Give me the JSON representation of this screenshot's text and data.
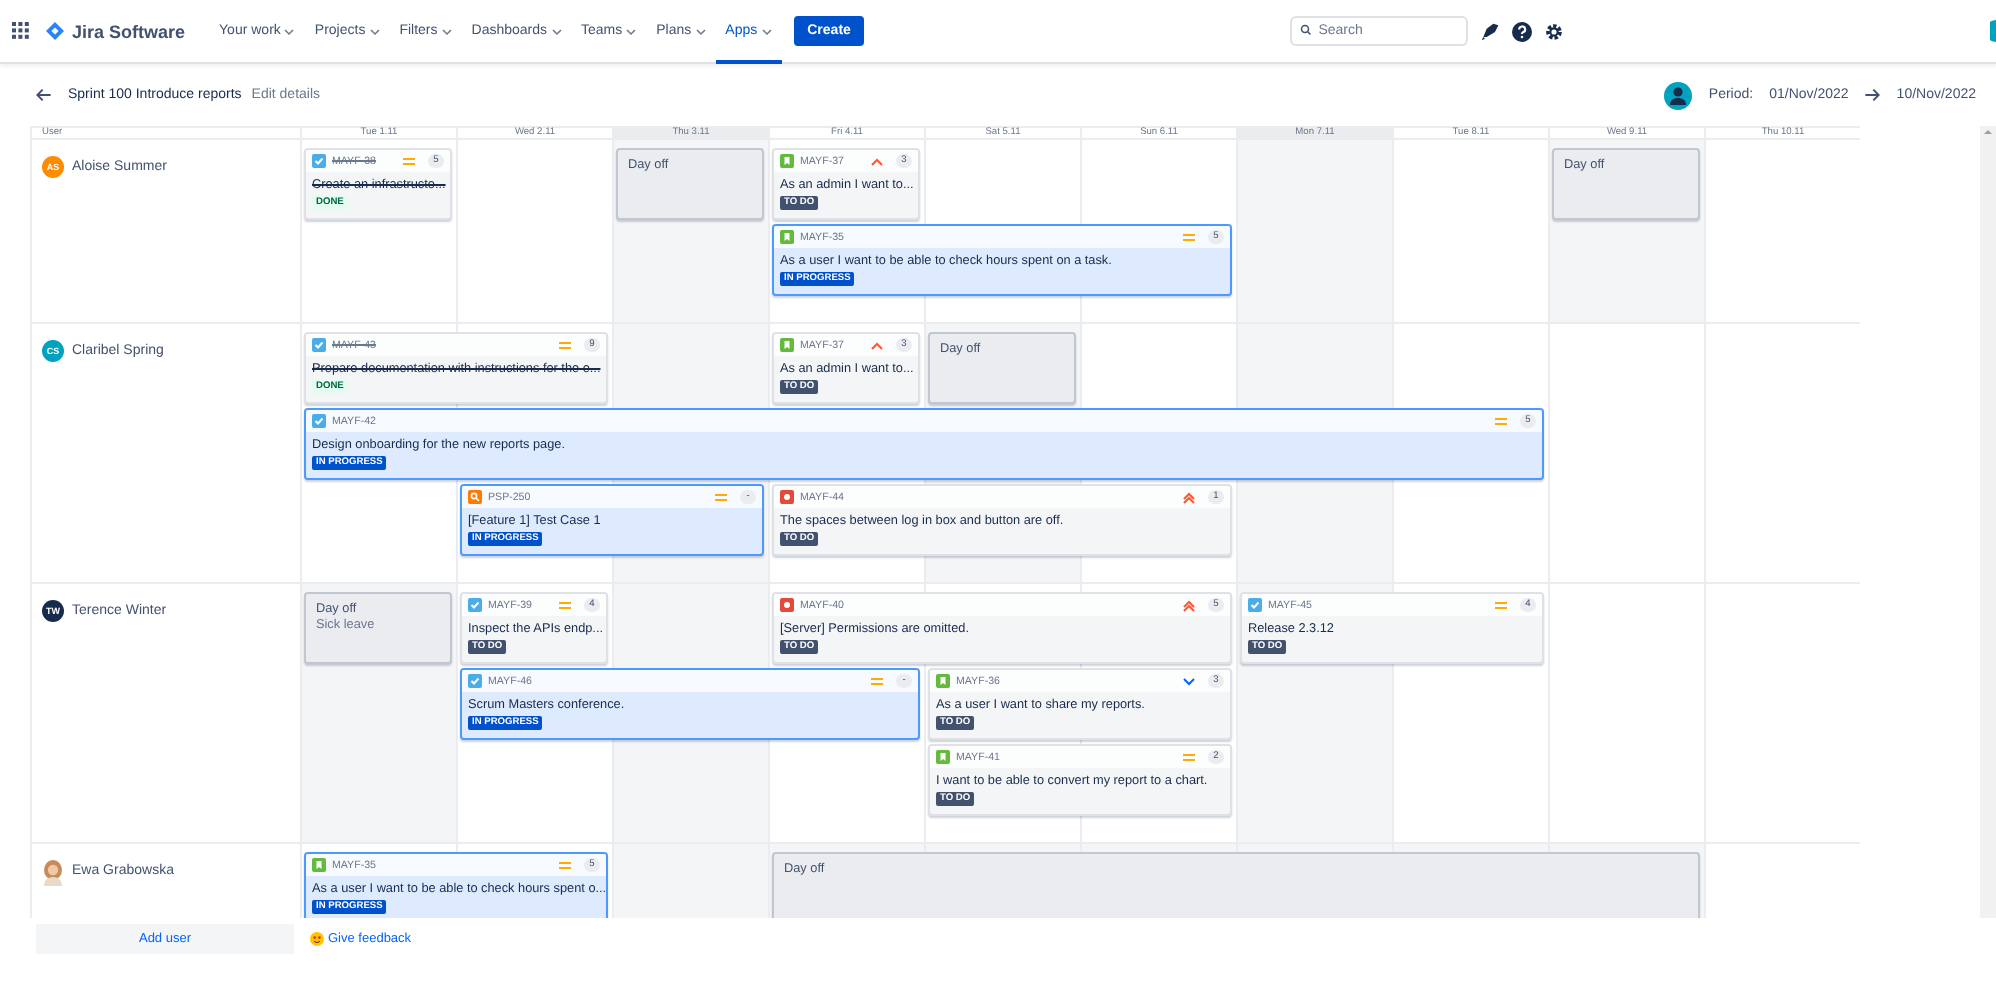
{
  "nav": {
    "product": "Jira Software",
    "menu": [
      {
        "label": "Your work",
        "selected": false
      },
      {
        "label": "Projects",
        "selected": false
      },
      {
        "label": "Filters",
        "selected": false
      },
      {
        "label": "Dashboards",
        "selected": false
      },
      {
        "label": "Teams",
        "selected": false
      },
      {
        "label": "Plans",
        "selected": false
      },
      {
        "label": "Apps",
        "selected": true
      }
    ],
    "create": "Create",
    "search": {
      "placeholder": "Search"
    }
  },
  "sprint": {
    "title": "Sprint 100 Introduce reports",
    "edit": "Edit details"
  },
  "period": {
    "label": "Period:",
    "start": "01/Nov/2022",
    "end": "10/Nov/2022"
  },
  "table": {
    "user_header": "User",
    "days": [
      {
        "label": "Tue 1.11",
        "shaded": false
      },
      {
        "label": "Wed 2.11",
        "shaded": false
      },
      {
        "label": "Thu 3.11",
        "shaded": true
      },
      {
        "label": "Fri 4.11",
        "shaded": false
      },
      {
        "label": "Sat 5.11",
        "shaded": false
      },
      {
        "label": "Sun 6.11",
        "shaded": false
      },
      {
        "label": "Mon 7.11",
        "shaded": true
      },
      {
        "label": "Tue 8.11",
        "shaded": false
      },
      {
        "label": "Wed 9.11",
        "shaded": false
      },
      {
        "label": "Thu 10.11",
        "shaded": false
      }
    ]
  },
  "users": [
    {
      "name": "Aloise Summer",
      "avatar": {
        "kind": "initials",
        "initials": "AS",
        "color": "#ff8b00"
      },
      "lanes": [
        [
          {
            "kind": "issue",
            "key": "MAYF-38",
            "icon": {
              "kind": "task"
            },
            "priority": {
              "kind": "medium"
            },
            "points": "5",
            "title": "Create an infrastructo...",
            "status": {
              "label": "DONE",
              "kind": "done"
            }
          },
          {
            "kind": "empty"
          },
          {
            "kind": "day_off",
            "title": "Day off"
          },
          {
            "kind": "issue",
            "key": "MAYF-37",
            "icon": {
              "kind": "story"
            },
            "priority": {
              "kind": "high"
            },
            "points": "3",
            "title": "As an admin I want to...",
            "status": {
              "label": "TO DO",
              "kind": "todo"
            }
          },
          {
            "kind": "empty"
          },
          {
            "kind": "empty"
          },
          {
            "kind": "empty"
          },
          {
            "kind": "empty"
          },
          {
            "kind": "day_off",
            "title": "Day off"
          },
          {
            "kind": "empty"
          }
        ],
        [
          {
            "kind": "empty"
          },
          {
            "kind": "empty"
          },
          {
            "kind": "empty"
          },
          {
            "kind": "issue",
            "key": "MAYF-35",
            "icon": {
              "kind": "story"
            },
            "priority": {
              "kind": "medium"
            },
            "points": "5",
            "title": "As a user I want to be able to check hours spent on a task.",
            "status": {
              "label": "IN PROGRESS",
              "kind": "in_progress"
            }
          },
          {
            "kind": "continued"
          },
          {
            "kind": "continued"
          },
          {
            "kind": "empty"
          },
          {
            "kind": "empty"
          },
          {
            "kind": "empty"
          },
          {
            "kind": "empty"
          }
        ]
      ]
    },
    {
      "name": "Claribel Spring",
      "avatar": {
        "kind": "initials",
        "initials": "CS",
        "color": "#00a3bf"
      },
      "lanes": [
        [
          {
            "kind": "issue",
            "key": "MAYF-43",
            "icon": {
              "kind": "task"
            },
            "priority": {
              "kind": "medium"
            },
            "points": "9",
            "title": "Prepare documentation with instructions for the e...",
            "status": {
              "label": "DONE",
              "kind": "done"
            }
          },
          {
            "kind": "continued"
          },
          {
            "kind": "empty"
          },
          {
            "kind": "issue",
            "key": "MAYF-37",
            "icon": {
              "kind": "story"
            },
            "priority": {
              "kind": "high"
            },
            "points": "3",
            "title": "As an admin I want to...",
            "status": {
              "label": "TO DO",
              "kind": "todo"
            }
          },
          {
            "kind": "day_off",
            "title": "Day off"
          },
          {
            "kind": "empty"
          },
          {
            "kind": "empty"
          },
          {
            "kind": "empty"
          },
          {
            "kind": "empty"
          },
          {
            "kind": "empty"
          }
        ],
        [
          {
            "kind": "issue",
            "key": "MAYF-42",
            "icon": {
              "kind": "task"
            },
            "priority": {
              "kind": "medium"
            },
            "points": "5",
            "title": "Design onboarding for the new reports page.",
            "status": {
              "label": "IN PROGRESS",
              "kind": "in_progress"
            }
          },
          {
            "kind": "continued"
          },
          {
            "kind": "continued"
          },
          {
            "kind": "continued"
          },
          {
            "kind": "continued"
          },
          {
            "kind": "continued"
          },
          {
            "kind": "continued"
          },
          {
            "kind": "continued"
          },
          {
            "kind": "empty"
          },
          {
            "kind": "empty"
          }
        ],
        [
          {
            "kind": "empty"
          },
          {
            "kind": "issue",
            "key": "PSP-250",
            "icon": {
              "kind": "test"
            },
            "priority": {
              "kind": "medium"
            },
            "points": "-",
            "title": "[Feature 1] Test Case 1",
            "status": {
              "label": "IN PROGRESS",
              "kind": "in_progress"
            }
          },
          {
            "kind": "continued"
          },
          {
            "kind": "issue",
            "key": "MAYF-44",
            "icon": {
              "kind": "bug"
            },
            "priority": {
              "kind": "highest"
            },
            "points": "1",
            "title": "The spaces between log in box and button are off.",
            "status": {
              "label": "TO DO",
              "kind": "todo"
            }
          },
          {
            "kind": "continued"
          },
          {
            "kind": "continued"
          },
          {
            "kind": "empty"
          },
          {
            "kind": "empty"
          },
          {
            "kind": "empty"
          },
          {
            "kind": "empty"
          }
        ]
      ]
    },
    {
      "name": "Terence Winter",
      "avatar": {
        "kind": "initials",
        "initials": "TW",
        "color": "#172b4d"
      },
      "lanes": [
        [
          {
            "kind": "day_off",
            "title": "Day off",
            "note": "Sick leave"
          },
          {
            "kind": "issue",
            "key": "MAYF-39",
            "icon": {
              "kind": "task"
            },
            "priority": {
              "kind": "medium"
            },
            "points": "4",
            "title": "Inspect the APIs endp...",
            "status": {
              "label": "TO DO",
              "kind": "todo"
            }
          },
          {
            "kind": "empty"
          },
          {
            "kind": "issue",
            "key": "MAYF-40",
            "icon": {
              "kind": "bug"
            },
            "priority": {
              "kind": "highest"
            },
            "points": "5",
            "title": "[Server] Permissions are omitted.",
            "status": {
              "label": "TO DO",
              "kind": "todo"
            }
          },
          {
            "kind": "continued"
          },
          {
            "kind": "continued"
          },
          {
            "kind": "issue",
            "key": "MAYF-45",
            "icon": {
              "kind": "task"
            },
            "priority": {
              "kind": "medium"
            },
            "points": "4",
            "title": "Release 2.3.12",
            "status": {
              "label": "TO DO",
              "kind": "todo"
            }
          },
          {
            "kind": "continued"
          },
          {
            "kind": "empty"
          },
          {
            "kind": "empty"
          }
        ],
        [
          {
            "kind": "empty"
          },
          {
            "kind": "issue",
            "key": "MAYF-46",
            "icon": {
              "kind": "task"
            },
            "priority": {
              "kind": "medium"
            },
            "points": "-",
            "title": "Scrum Masters conference.",
            "status": {
              "label": "IN PROGRESS",
              "kind": "in_progress"
            }
          },
          {
            "kind": "continued"
          },
          {
            "kind": "continued"
          },
          {
            "kind": "issue",
            "key": "MAYF-36",
            "icon": {
              "kind": "story"
            },
            "priority": {
              "kind": "low"
            },
            "points": "3",
            "title": "As a user I want to share my reports.",
            "status": {
              "label": "TO DO",
              "kind": "todo"
            }
          },
          {
            "kind": "continued"
          },
          {
            "kind": "empty"
          },
          {
            "kind": "empty"
          },
          {
            "kind": "empty"
          },
          {
            "kind": "empty"
          }
        ],
        [
          {
            "kind": "empty"
          },
          {
            "kind": "empty"
          },
          {
            "kind": "empty"
          },
          {
            "kind": "empty"
          },
          {
            "kind": "issue",
            "key": "MAYF-41",
            "icon": {
              "kind": "story"
            },
            "priority": {
              "kind": "medium"
            },
            "points": "2",
            "title": "I want to be able to convert my report to a chart.",
            "status": {
              "label": "TO DO",
              "kind": "todo"
            }
          },
          {
            "kind": "continued"
          },
          {
            "kind": "empty"
          },
          {
            "kind": "empty"
          },
          {
            "kind": "empty"
          },
          {
            "kind": "empty"
          }
        ]
      ]
    },
    {
      "name": "Ewa Grabowska",
      "avatar": {
        "kind": "photo"
      },
      "lanes": [
        [
          {
            "kind": "issue",
            "key": "MAYF-35",
            "icon": {
              "kind": "story"
            },
            "priority": {
              "kind": "medium"
            },
            "points": "5",
            "title": "As a user I want to be able to check hours spent o...",
            "status": {
              "label": "IN PROGRESS",
              "kind": "in_progress"
            }
          },
          {
            "kind": "continued"
          },
          {
            "kind": "empty"
          },
          {
            "kind": "day_off",
            "title": "Day off"
          },
          {
            "kind": "continued"
          },
          {
            "kind": "continued"
          },
          {
            "kind": "continued"
          },
          {
            "kind": "continued"
          },
          {
            "kind": "continued"
          },
          {
            "kind": "empty"
          }
        ]
      ]
    }
  ],
  "footer": {
    "add_user": "Add user",
    "feedback": "Give feedback"
  }
}
